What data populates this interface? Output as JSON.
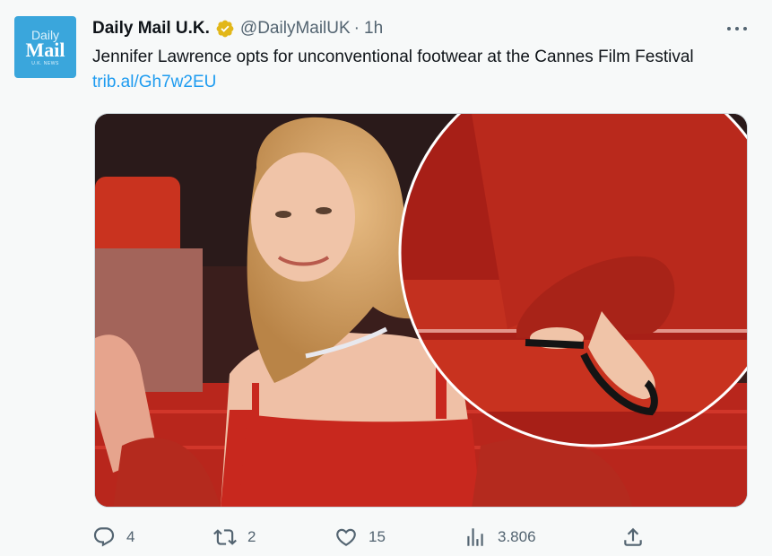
{
  "tweet": {
    "author_name": "Daily Mail U.K.",
    "handle": "@DailyMailUK",
    "separator": "·",
    "time": "1h",
    "text": "Jennifer Lawrence opts for unconventional footwear at the Cannes Film Festival",
    "link": "trib.al/Gh7w2EU",
    "avatar": {
      "line1": "Daily",
      "line2": "Mail",
      "line3": "U.K. NEWS"
    },
    "verified_color": "#e2b719"
  },
  "actions": {
    "replies": "4",
    "retweets": "2",
    "likes": "15",
    "views": "3.806"
  },
  "colors": {
    "accent": "#1d9bf0",
    "muted": "#536471",
    "avatar_bg": "#3aa6dc",
    "carpet_red": "#c8281e"
  }
}
